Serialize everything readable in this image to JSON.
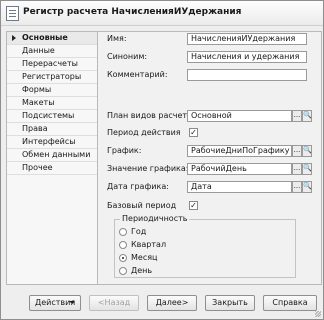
{
  "window": {
    "title": "Регистр расчета НачисленияИУдержания"
  },
  "nav": {
    "items": [
      {
        "label": "Основные",
        "active": true
      },
      {
        "label": "Данные"
      },
      {
        "label": "Перерасчеты"
      },
      {
        "label": "Регистраторы"
      },
      {
        "label": "Формы"
      },
      {
        "label": "Макеты"
      },
      {
        "label": "Подсистемы"
      },
      {
        "label": "Права"
      },
      {
        "label": "Интерфейсы"
      },
      {
        "label": "Обмен данными"
      },
      {
        "label": "Прочее"
      }
    ]
  },
  "form": {
    "name_label": "Имя:",
    "name_value": "НачисленияИУдержания",
    "synonym_label": "Синоним:",
    "synonym_value": "Начисления и удержания",
    "comment_label": "Комментарий:",
    "comment_value": "",
    "plan_label": "План видов расчета:",
    "plan_value": "Основной",
    "period_action_label": "Период действия",
    "period_action_checked": true,
    "schedule_label": "График:",
    "schedule_value": "РабочиеДниПоГрафику",
    "schedule_value_label": "Значение графика:",
    "schedule_value_value": "РабочийДень",
    "schedule_date_label": "Дата графика:",
    "schedule_date_value": "Дата",
    "base_period_label": "Базовый период",
    "base_period_checked": true,
    "check_mark": "✓",
    "pick_button": "...",
    "search_button": "🔍"
  },
  "periodicity": {
    "title": "Периодичность",
    "options": [
      {
        "label": "Год",
        "selected": false
      },
      {
        "label": "Квартал",
        "selected": false
      },
      {
        "label": "Месяц",
        "selected": true
      },
      {
        "label": "День",
        "selected": false
      }
    ]
  },
  "footer": {
    "actions_label": "Действия",
    "back_label": "<Назад",
    "next_label": "Далее>",
    "close_label": "Закрыть",
    "help_label": "Справка"
  }
}
